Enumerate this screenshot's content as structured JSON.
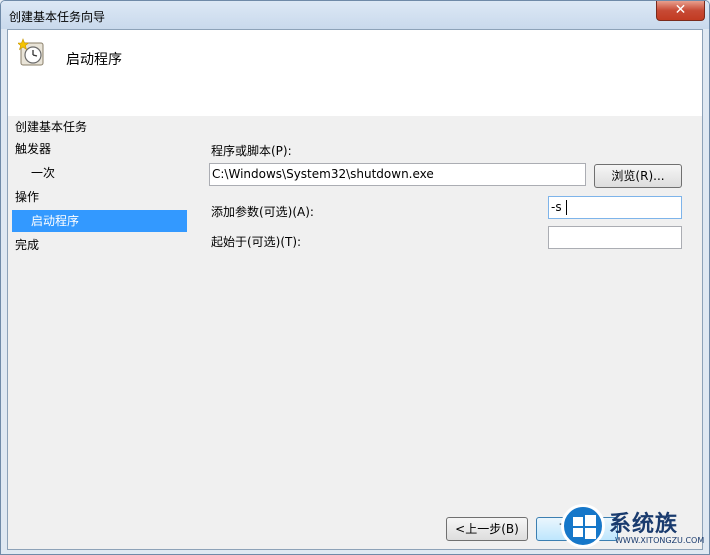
{
  "window": {
    "title": "创建基本任务向导",
    "close_glyph": "✕"
  },
  "header": {
    "title": "启动程序",
    "icon": "clock-task-icon"
  },
  "steps": {
    "title": "创建基本任务",
    "items": [
      {
        "label": "触发器",
        "level": 0,
        "active": false
      },
      {
        "label": "一次",
        "level": 1,
        "active": false
      },
      {
        "label": "操作",
        "level": 0,
        "active": false
      },
      {
        "label": "启动程序",
        "level": 1,
        "active": true
      },
      {
        "label": "完成",
        "level": 0,
        "active": false
      }
    ]
  },
  "form": {
    "program_label": "程序或脚本(P):",
    "program_value": "C:\\Windows\\System32\\shutdown.exe",
    "browse_label": "浏览(R)...",
    "args_label": "添加参数(可选)(A):",
    "args_value": "-s",
    "startin_label": "起始于(可选)(T):",
    "startin_value": ""
  },
  "footer": {
    "back_label": "<上一步(B)",
    "next_label": "下一步"
  },
  "watermark": {
    "brand": "系统族",
    "url": "WWW.XITONGZU.COM"
  },
  "colors": {
    "selection": "#3399ff",
    "close_button": "#c74a35"
  }
}
